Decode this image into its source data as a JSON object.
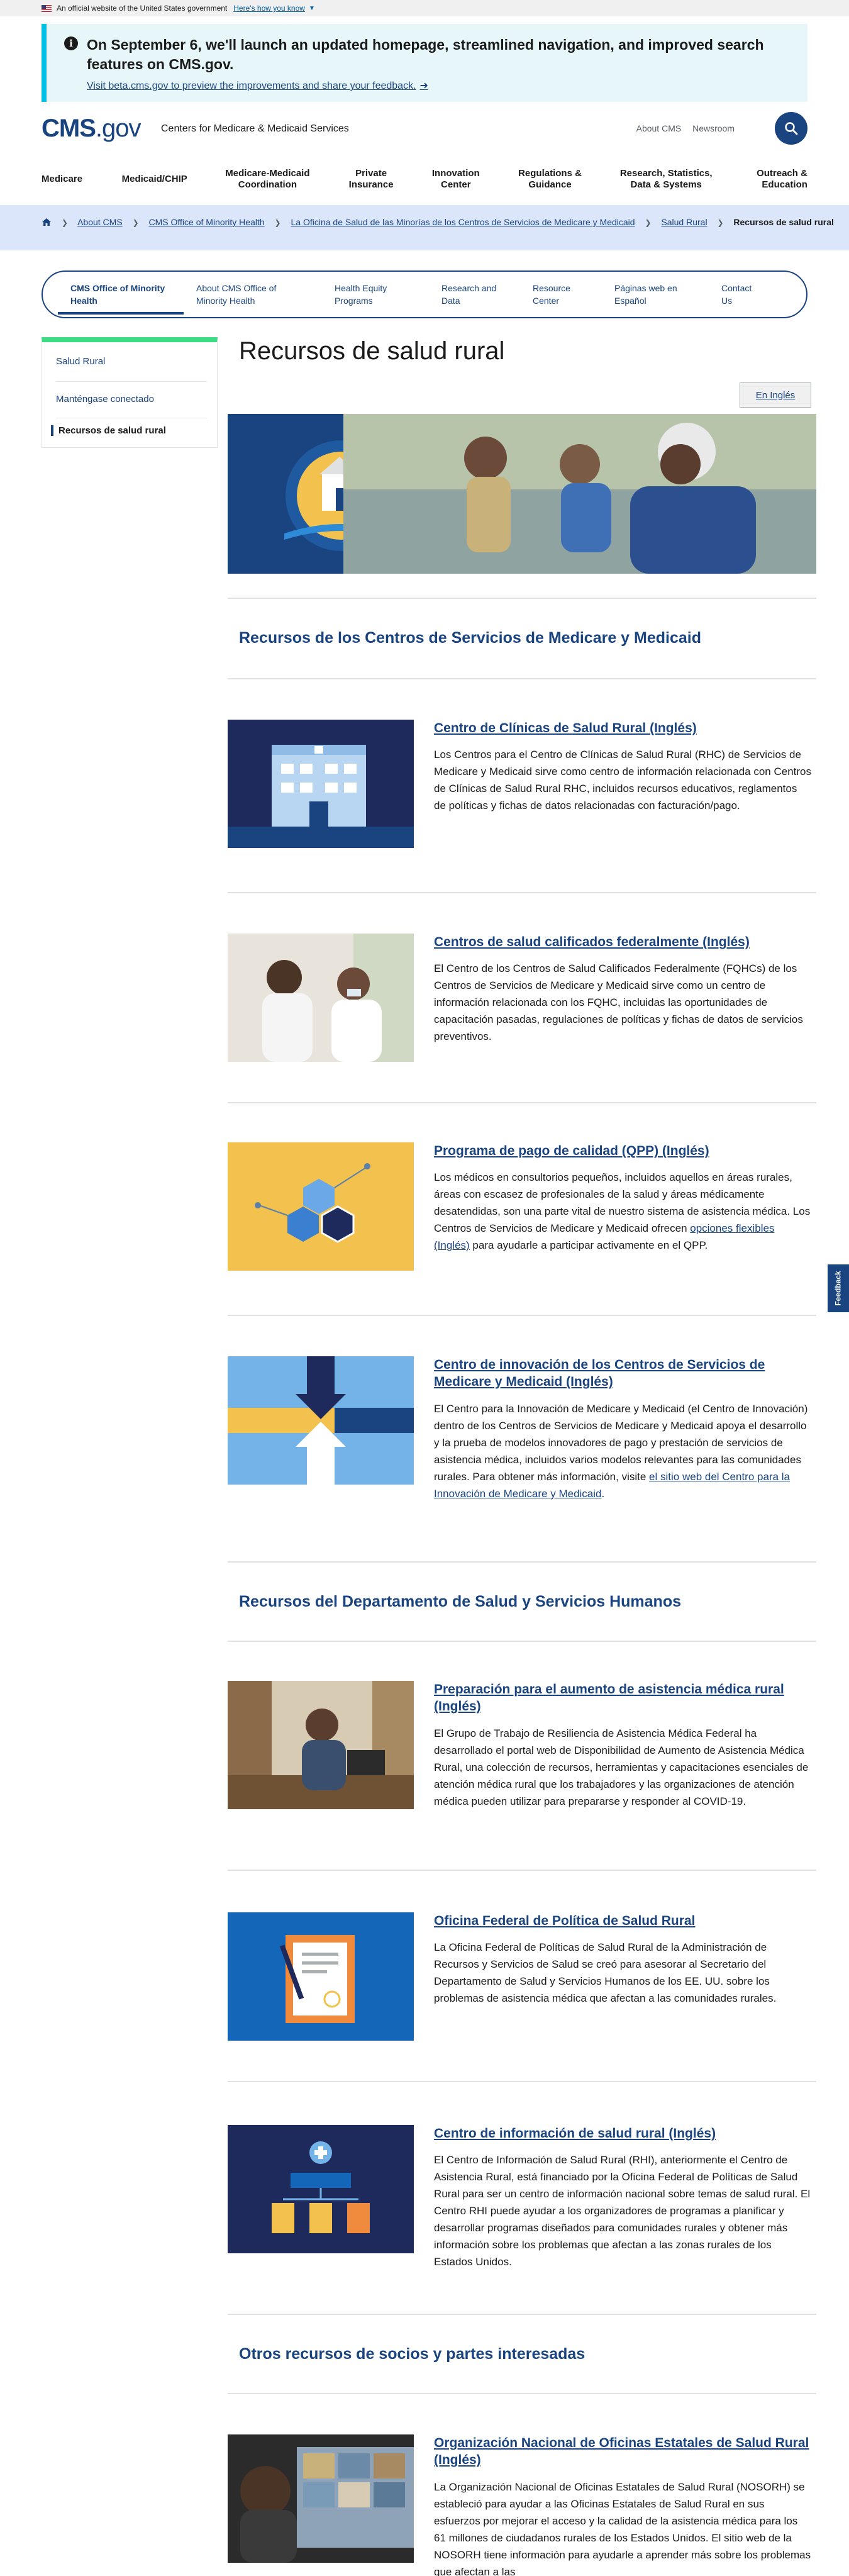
{
  "gov_banner": {
    "text": "An official website of the United States government",
    "link": "Here's how you know"
  },
  "alert": {
    "title": "On September 6, we'll launch an updated homepage, streamlined navigation, and improved search features on CMS.gov.",
    "link": "Visit beta.cms.gov to preview the improvements and share your feedback."
  },
  "header": {
    "logo_main": "CMS",
    "logo_suffix": ".gov",
    "logo_sub": "Centers for Medicare & Medicaid Services",
    "utility": [
      "About CMS",
      "Newsroom"
    ]
  },
  "main_nav": [
    "Medicare",
    "Medicaid/CHIP",
    "Medicare-Medicaid Coordination",
    "Private Insurance",
    "Innovation Center",
    "Regulations & Guidance",
    "Research, Statistics, Data & Systems",
    "Outreach & Education"
  ],
  "breadcrumb": {
    "items": [
      "About CMS",
      "CMS Office of Minority Health",
      "La Oficina de Salud de las Minorías de los Centros de Servicios de Medicare y Medicaid",
      "Salud Rural"
    ],
    "current": "Recursos de salud rural"
  },
  "section_nav": [
    "CMS Office of Minority Health",
    "About CMS Office of Minority Health",
    "Health Equity Programs",
    "Research and Data",
    "Resource Center",
    "Páginas web en Español",
    "Contact Us"
  ],
  "sidenav": [
    "Salud Rural",
    "Manténgase conectado",
    "Recursos de salud rural"
  ],
  "page": {
    "title": "Recursos de salud rural",
    "lang_button": "En Inglés"
  },
  "sections": [
    "Recursos de los Centros de Servicios de Medicare y Medicaid",
    "Recursos del Departamento de Salud y Servicios Humanos",
    "Otros recursos de socios y partes interesadas"
  ],
  "cards": [
    {
      "title": "Centro de Clínicas de Salud Rural (Inglés)",
      "body": "Los Centros para el Centro de Clínicas de Salud Rural (RHC) de Servicios de Medicare y Medicaid sirve como centro de información relacionada con Centros de Clínicas de Salud Rural RHC, incluidos recursos educativos, reglamentos de políticas y fichas de datos relacionadas con facturación/pago."
    },
    {
      "title": "Centros de salud calificados federalmente (Inglés)",
      "body": "El Centro de los Centros de Salud Calificados Federalmente (FQHCs) de los Centros de Servicios de Medicare y Medicaid sirve como un centro de información relacionada con los FQHC, incluidas las oportunidades de capacitación pasadas, regulaciones de políticas y fichas de datos de servicios preventivos."
    },
    {
      "title": "Programa de pago de calidad (QPP) (Inglés)",
      "body_a": "Los médicos en consultorios pequeños, incluidos aquellos en áreas rurales, áreas con escasez de profesionales de la salud y áreas médicamente desatendidas, son una parte vital de nuestro sistema de asistencia médica. Los Centros de Servicios de Medicare y Medicaid ofrecen ",
      "body_link": "opciones flexibles (Inglés)",
      "body_b": " para ayudarle a participar activamente en el QPP."
    },
    {
      "title": "Centro de innovación de los Centros de Servicios de Medicare y Medicaid (Inglés)",
      "body_a": "El Centro para la Innovación de Medicare y Medicaid (el Centro de Innovación) dentro de los Centros de Servicios de Medicare y Medicaid apoya el desarrollo y la prueba de modelos innovadores de pago y prestación de servicios de asistencia médica, incluidos varios modelos relevantes para las comunidades rurales. Para obtener más información, visite ",
      "body_link": "el sitio web del Centro para la Innovación de Medicare y Medicaid",
      "body_b": "."
    },
    {
      "title": "Preparación para el aumento de asistencia médica rural (Inglés)",
      "body": "El Grupo de Trabajo de Resiliencia de Asistencia Médica Federal ha desarrollado el portal web de Disponibilidad de Aumento de Asistencia Médica Rural, una colección de recursos, herramientas y capacitaciones esenciales de atención médica rural que los trabajadores y las organizaciones de atención médica pueden utilizar para prepararse y responder al COVID-19."
    },
    {
      "title": "Oficina Federal de Política de Salud Rural",
      "body": "La Oficina Federal de Políticas de Salud Rural de la Administración de Recursos y Servicios de Salud se creó para asesorar al Secretario del Departamento de Salud y Servicios Humanos de los EE. UU. sobre los problemas de asistencia médica que afectan a las comunidades rurales."
    },
    {
      "title": "Centro de información de salud rural (Inglés)",
      "body": "El Centro de Información de Salud Rural (RHI), anteriormente el Centro de Asistencia Rural, está financiado por la Oficina Federal de Políticas de Salud Rural para ser un centro de información nacional sobre temas de salud rural. El Centro RHI puede ayudar a los organizadores de programas a planificar y desarrollar programas diseñados para comunidades rurales y obtener más información sobre los problemas que afectan a las zonas rurales de los Estados Unidos."
    },
    {
      "title": "Organización Nacional de Oficinas Estatales de Salud Rural (Inglés)",
      "body": "La Organización Nacional de Oficinas Estatales de Salud Rural (NOSORH) se estableció para ayudar a las Oficinas Estatales de Salud Rural en sus esfuerzos por mejorar el acceso y la calidad de la asistencia médica para los 61 millones de ciudadanos rurales de los Estados Unidos. El sitio web de la NOSORH tiene información para ayudarle a aprender más sobre los problemas que afectan a las"
    }
  ],
  "feedback": "Feedback",
  "colors": {
    "primary": "#1a4480",
    "alert_bg": "#e7f6f8",
    "alert_border": "#00bde3",
    "breadcrumb_bg": "#dbe6fa",
    "sidenav_accent": "#3ddc84"
  }
}
